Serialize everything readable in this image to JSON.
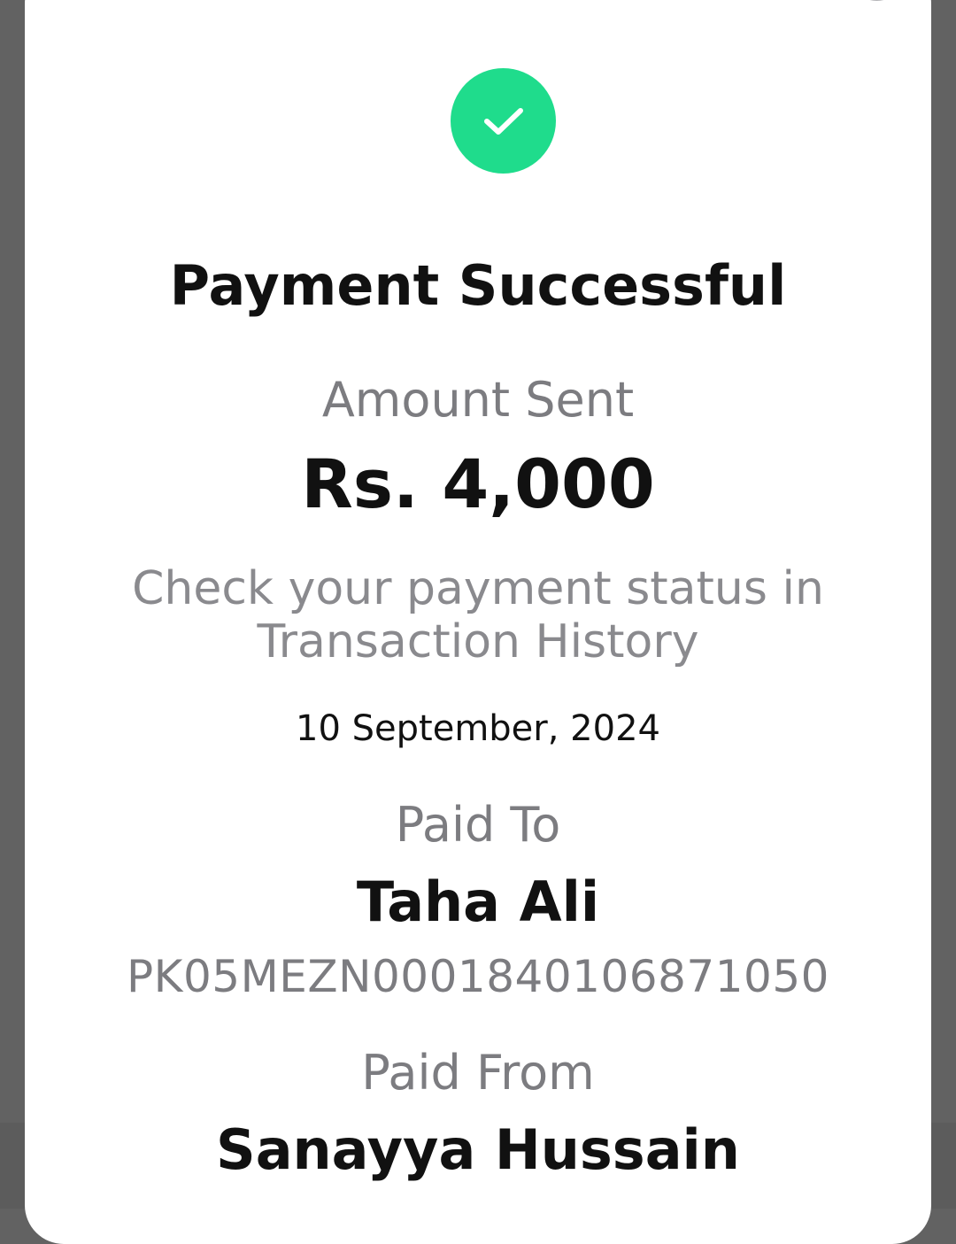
{
  "dialog": {
    "close_icon": "close-icon",
    "status_icon": "check-icon",
    "title": "Payment Successful",
    "amount_label": "Amount Sent",
    "amount": "Rs. 4,000",
    "status_note_line1": "Check your payment status in",
    "status_note_line2": "Transaction History",
    "date": "10 September, 2024",
    "paid_to": {
      "label": "Paid To",
      "name": "Taha Ali",
      "account": "PK05MEZN0001840106871050"
    },
    "paid_from": {
      "label": "Paid From",
      "name": "Sanayya Hussain"
    }
  },
  "colors": {
    "success": "#1fdc8c",
    "close_button": "#b3b3b6",
    "backdrop": "#626262",
    "text_primary": "#111111",
    "text_muted": "#7c7c80"
  }
}
